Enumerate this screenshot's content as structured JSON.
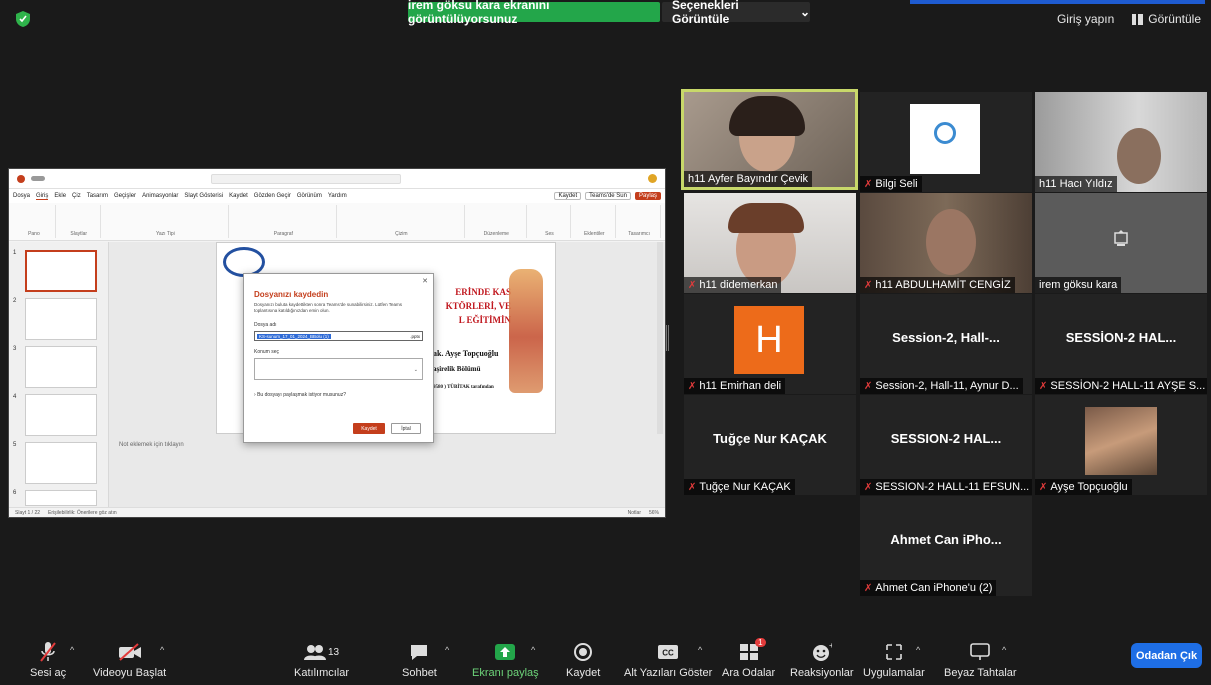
{
  "top": {
    "share_banner": "irem göksu kara ekranını görüntülüyorsunuz",
    "view_options": "Seçenekleri Görüntüle",
    "signin": "Giriş yapın",
    "view_label": "Görüntüle"
  },
  "powerpoint": {
    "tabs": [
      "Dosya",
      "Giriş",
      "Ekle",
      "Çiz",
      "Tasarım",
      "Geçişler",
      "Animasyonlar",
      "Slayt Gösterisi",
      "Kaydet",
      "Gözden Geçir",
      "Görünüm",
      "Yardım"
    ],
    "record_btn": "Kaydet",
    "teams_btn": "Teams'de Sun",
    "share_btn": "Paylaş",
    "ribbon_groups": [
      "Pano",
      "Slaytlar",
      "Yazı Tipi",
      "Paragraf",
      "Çizim",
      "Düzenleme",
      "Ses",
      "Eklentiler",
      "Tasarımcı"
    ],
    "slide_numbers": [
      "1",
      "2",
      "3",
      "4",
      "5",
      "6"
    ],
    "slide_red_lines": [
      "ERİNDE KAS",
      "KTÖRLERİ, VE",
      "L EĞİTİMİN"
    ],
    "slide_body_lines": [
      "ak. Ayşe Topçuoğlu",
      "aşirelik Bölümü",
      "9580 ) TÜBİTAK tarafından"
    ],
    "notes_placeholder": "Not eklemek için tıklayın",
    "status_left": "Slayt 1 / 22",
    "status_accessibility": "Erişilebilirlik: Önerilere göz atın",
    "status_notes": "Notlar",
    "zoom": "56%"
  },
  "dialog": {
    "title": "Dosyanızı kaydedin",
    "description": "Dosyanızı buluta kaydettikten sonra Teams'de sunabilirsiniz. Lütfen Teams toplantısına katıldığınızdan emin olun.",
    "filename_label": "Dosya adı",
    "filename_value": "KS-sunum_17_01_2024_BBolu (1)",
    "extension": ".pptx",
    "location_label": "Konum seç",
    "share_question": "Bu dosyayı paylaşmak istiyor musunuz?",
    "save_btn": "Kaydet",
    "cancel_btn": "İptal"
  },
  "participants": [
    {
      "name": "h11 Ayfer Bayındır Çevik",
      "muted": false
    },
    {
      "name": "Bilgi Seli",
      "muted": true
    },
    {
      "name": "h11 Hacı Yıldız",
      "muted": false
    },
    {
      "name": "h11 didemerkan",
      "muted": true
    },
    {
      "name": "h11 ABDULHAMİT CENGİZ",
      "muted": true
    },
    {
      "name": "irem göksu kara",
      "muted": false
    },
    {
      "name": "h11 Emirhan deli",
      "muted": true,
      "avatar": "H"
    },
    {
      "name": "Session-2, Hall-11, Aynur D...",
      "muted": true,
      "center": "Session-2, Hall-..."
    },
    {
      "name": "SESSİON-2 HALL-11 AYŞE S...",
      "muted": true,
      "center": "SESSİON-2 HAL..."
    },
    {
      "name": "Tuğçe Nur KAÇAK",
      "muted": true,
      "center": "Tuğçe Nur KAÇAK"
    },
    {
      "name": "SESSION-2 HALL-11 EFSUN...",
      "muted": true,
      "center": "SESSION-2 HAL..."
    },
    {
      "name": "Ayşe Topçuoğlu",
      "muted": true
    },
    {
      "name": "Ahmet Can iPhone'u (2)",
      "muted": true,
      "center": "Ahmet Can iPho..."
    }
  ],
  "toolbar": {
    "audio": "Sesi aç",
    "video": "Videoyu Başlat",
    "participants": "Katılımcılar",
    "participant_count": "13",
    "chat": "Sohbet",
    "share": "Ekranı paylaş",
    "record": "Kaydet",
    "captions": "Alt Yazıları Göster",
    "rooms": "Ara Odalar",
    "rooms_badge": "1",
    "reactions": "Reaksiyonlar",
    "apps": "Uygulamalar",
    "whiteboards": "Beyaz Tahtalar",
    "leave": "Odadan Çık"
  },
  "colors": {
    "share_green": "#23a64a",
    "leave_blue": "#1e6ee5",
    "active_speaker": "#c8d86a",
    "ppt_red": "#c43e1c"
  }
}
